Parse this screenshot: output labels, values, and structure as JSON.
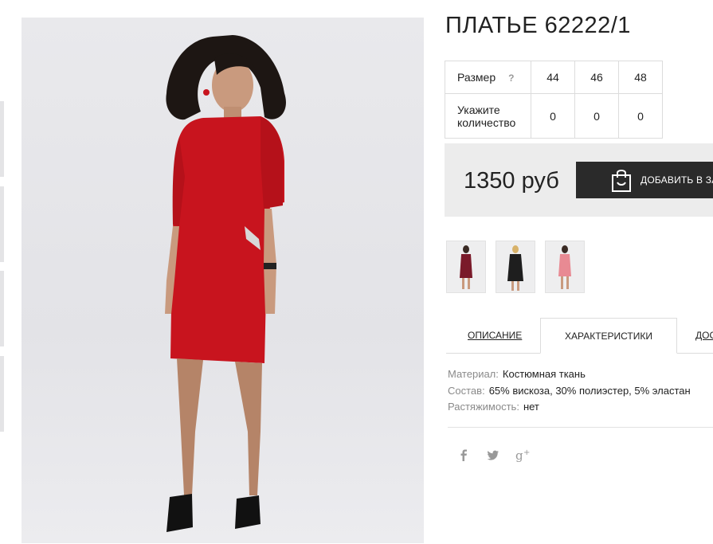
{
  "product": {
    "title": "ПЛАТЬЕ 62222/1"
  },
  "size_table": {
    "size_label": "Размер",
    "help_label": "?",
    "sizes": [
      "44",
      "46",
      "48"
    ],
    "qty_label": "Укажите количество",
    "quantities": [
      "0",
      "0",
      "0"
    ]
  },
  "purchase": {
    "price": "1350 руб",
    "add_to_cart_label": "ДОБАВИТЬ В ЗАКАЗ"
  },
  "colors": [
    {
      "name": "burgundy",
      "color": "#7a1a2a"
    },
    {
      "name": "black",
      "color": "#1e1e1e"
    },
    {
      "name": "pink",
      "color": "#e88a93"
    }
  ],
  "tabs": {
    "description": "ОПИСАНИЕ",
    "characteristics": "ХАРАКТЕРИСТИКИ",
    "delivery": "ДОСТАВКА"
  },
  "specs": [
    {
      "key": "Материал:",
      "value": "Костюмная ткань"
    },
    {
      "key": "Состав:",
      "value": "65% вискоза, 30% полиэстер, 5% эластан"
    },
    {
      "key": "Растяжимость:",
      "value": "нет"
    }
  ],
  "social_icons": [
    "facebook-icon",
    "twitter-icon",
    "google-plus-icon"
  ],
  "accent_colors": {
    "dress": "#c8141e",
    "button": "#2a2a2a",
    "price_bg": "#ececec"
  }
}
